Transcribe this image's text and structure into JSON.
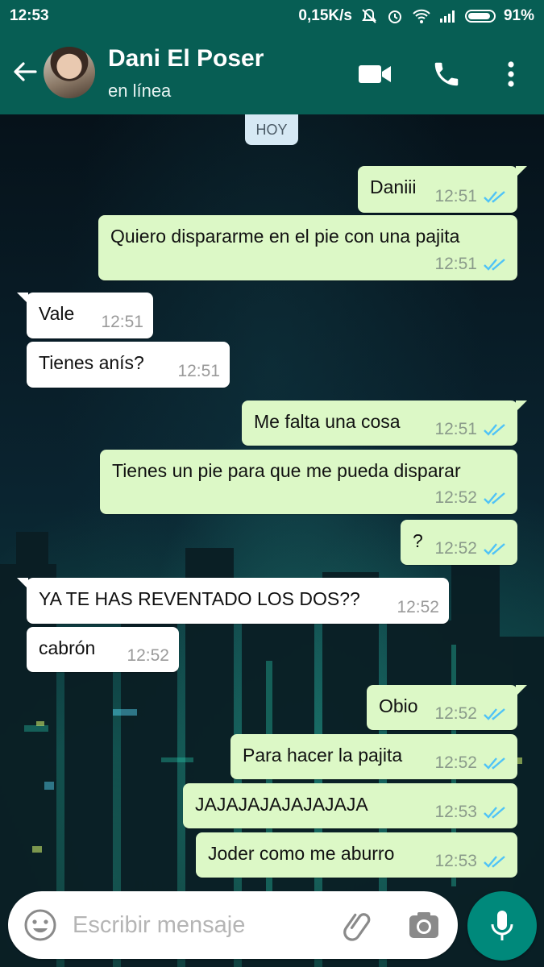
{
  "status_bar": {
    "time": "12:53",
    "net_speed": "0,15K/s",
    "battery": "91%"
  },
  "header": {
    "contact_name": "Dani El Poser",
    "contact_status": "en línea"
  },
  "chat": {
    "day_chip": "HOY",
    "messages": [
      {
        "dir": "out",
        "text": "Daniii",
        "time": "12:51",
        "ticks": "read"
      },
      {
        "dir": "out",
        "text": "Quiero dispararme en el pie con una pajita",
        "time": "12:51",
        "ticks": "read"
      },
      {
        "dir": "in",
        "text": "Vale",
        "time": "12:51"
      },
      {
        "dir": "in",
        "text": "Tienes anís?",
        "time": "12:51"
      },
      {
        "dir": "out",
        "text": "Me falta una cosa",
        "time": "12:51",
        "ticks": "read"
      },
      {
        "dir": "out",
        "text": "Tienes un pie para que me pueda disparar",
        "time": "12:52",
        "ticks": "read"
      },
      {
        "dir": "out",
        "text": "?",
        "time": "12:52",
        "ticks": "read"
      },
      {
        "dir": "in",
        "text": "YA TE HAS REVENTADO LOS DOS??",
        "time": "12:52"
      },
      {
        "dir": "in",
        "text": "cabrón",
        "time": "12:52"
      },
      {
        "dir": "out",
        "text": "Obio",
        "time": "12:52",
        "ticks": "read"
      },
      {
        "dir": "out",
        "text": "Para hacer la pajita",
        "time": "12:52",
        "ticks": "read"
      },
      {
        "dir": "out",
        "text": "JAJAJAJAJAJAJAJA",
        "time": "12:53",
        "ticks": "read"
      },
      {
        "dir": "out",
        "text": "Joder como me aburro",
        "time": "12:53",
        "ticks": "read"
      }
    ]
  },
  "composer": {
    "placeholder": "Escribir mensaje"
  },
  "colors": {
    "header": "#075e54",
    "outgoing_bubble": "#dcf8c6",
    "incoming_bubble": "#ffffff",
    "read_ticks": "#4fc3f7",
    "mic_button": "#00897b"
  },
  "icons": [
    "back-arrow-icon",
    "video-call-icon",
    "phone-icon",
    "more-vert-icon",
    "emoji-icon",
    "attach-clip-icon",
    "camera-icon",
    "mic-icon",
    "read-ticks-icon"
  ]
}
